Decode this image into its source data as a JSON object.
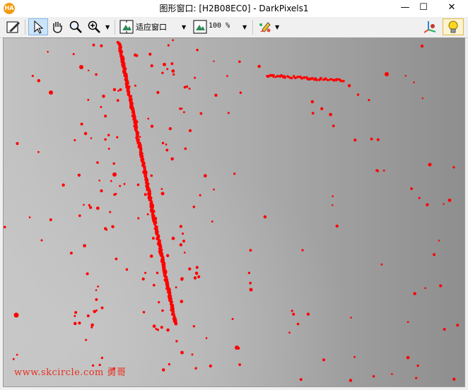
{
  "window": {
    "title": "图形窗口: [H2B08EC0] - DarkPixels1",
    "app_icon_label": "HA",
    "minimize": "—",
    "maximize": "☐",
    "close": "✕"
  },
  "toolbar": {
    "zoom_mode": "适应窗口",
    "zoom_percent": "100 %",
    "icons": [
      "edit-icon",
      "pointer-icon",
      "hand-pan-icon",
      "magnifier-icon",
      "zoom-in-icon",
      "fit-window-icon",
      "zoom-percent-icon",
      "color-palette-icon",
      "axis-3d-icon",
      "lightbulb-icon"
    ]
  },
  "image": {
    "description_colors": {
      "background_light": "#bdbdbd",
      "background_dark": "#8f8f8f",
      "defect": "#ff0000"
    },
    "watermark": "www.skcircle.com 勇哥"
  }
}
